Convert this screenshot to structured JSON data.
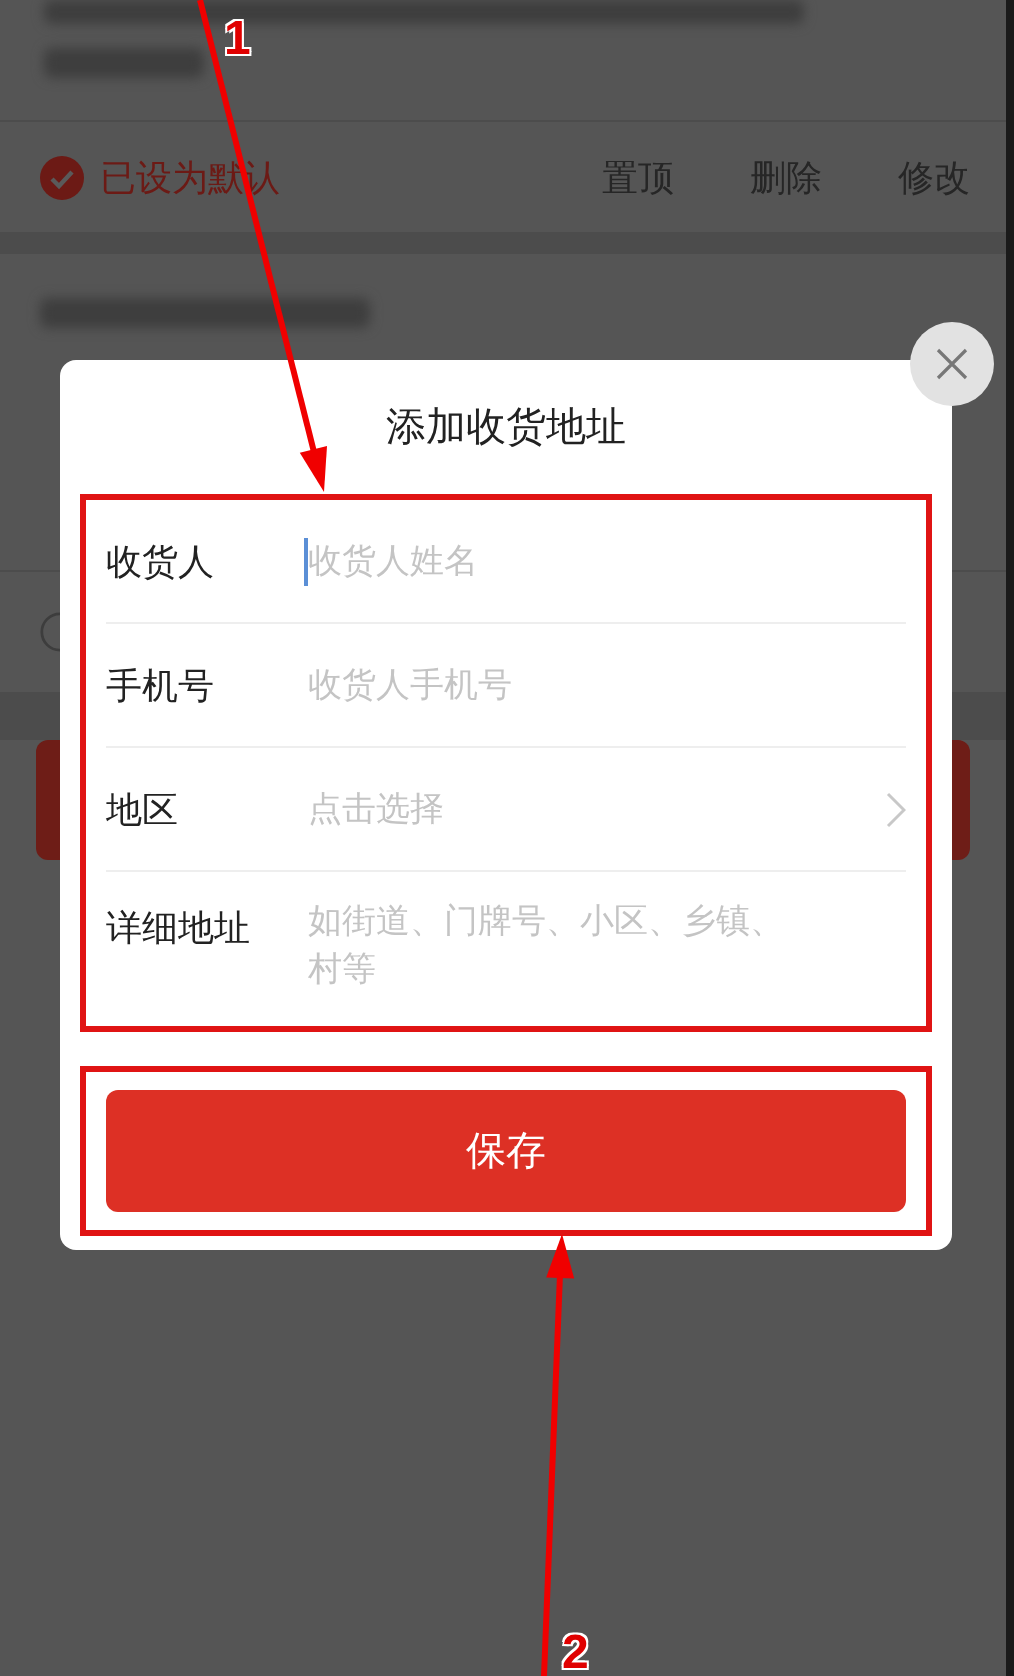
{
  "default_address": {
    "default_label": "已设为默认",
    "default_checked": true,
    "actions": [
      "置顶",
      "删除",
      "修改"
    ]
  },
  "second_address": {
    "default_checked": false
  },
  "dialog": {
    "title": "添加收货地址",
    "fields": [
      {
        "kind": "text",
        "label": "收货人",
        "placeholder": "收货人姓名",
        "focused": true
      },
      {
        "kind": "text",
        "label": "手机号",
        "placeholder": "收货人手机号",
        "focused": false
      },
      {
        "kind": "select",
        "label": "地区",
        "placeholder": "点击选择",
        "focused": false
      },
      {
        "kind": "textarea",
        "label": "详细地址",
        "placeholder": "如街道、门牌号、小区、乡镇、村等",
        "focused": false
      }
    ],
    "save_button": "保存"
  },
  "annotations": [
    {
      "number": "1"
    },
    {
      "number": "2"
    }
  ]
}
